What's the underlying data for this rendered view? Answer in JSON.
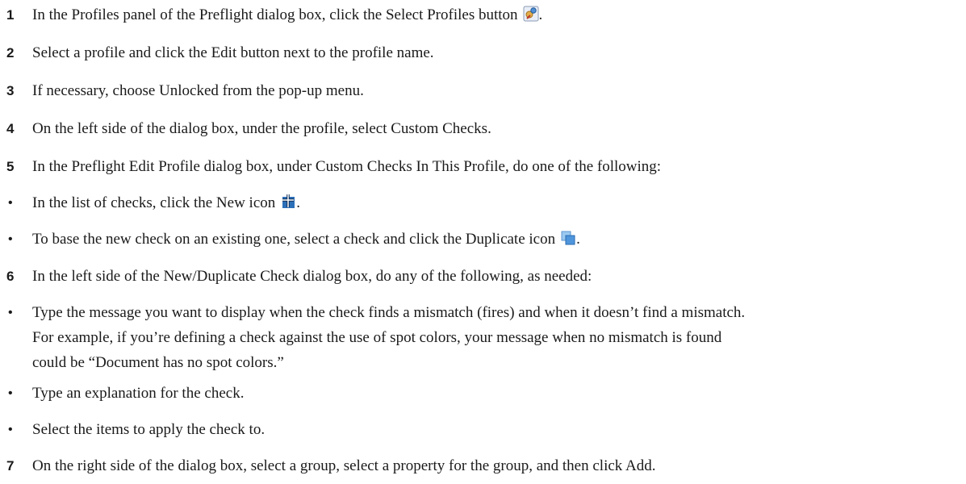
{
  "steps": [
    {
      "number": "1",
      "text": "In the Profiles panel of the Preflight dialog box, click the Select Profiles button",
      "suffix": ".",
      "icon": "select-profiles-icon"
    },
    {
      "number": "2",
      "text": "Select a profile and click the Edit button next to the profile name."
    },
    {
      "number": "3",
      "text": "If necessary, choose Unlocked from the pop-up menu."
    },
    {
      "number": "4",
      "text": "On the left side of the dialog box, under the profile, select Custom Checks."
    },
    {
      "number": "5",
      "text": "In the Preflight Edit Profile dialog box, under Custom Checks In This Profile, do one of the following:"
    },
    {
      "bullet": "•",
      "text": "In the list of checks, click the New icon",
      "suffix": ".",
      "icon": "new-icon"
    },
    {
      "bullet": "•",
      "text": "To base the new check on an existing one, select a check and click the Duplicate icon",
      "suffix": ".",
      "icon": "duplicate-icon"
    },
    {
      "number": "6",
      "text": "In the left side of the New/Duplicate Check dialog box, do any of the following, as needed:"
    },
    {
      "bullet": "•",
      "line1": "Type the message you want to display when the check finds a mismatch (fires) and when it doesn’t find a mismatch.",
      "line2": "For example, if you’re defining a check against the use of spot colors, your message when no mismatch is found",
      "line3": "could be “Document has no spot colors.”"
    },
    {
      "bullet": "•",
      "text": "Type an explanation for the check."
    },
    {
      "bullet": "•",
      "text": "Select the items to apply the check to."
    },
    {
      "number": "7",
      "text": "On the right side of the dialog box, select a group, select a property for the group, and then click Add."
    }
  ],
  "colors": {
    "text": "#1a1a1a",
    "icon_blue": "#2b6fb8",
    "icon_light_blue": "#7fb8ea",
    "icon_red": "#d9342b"
  }
}
